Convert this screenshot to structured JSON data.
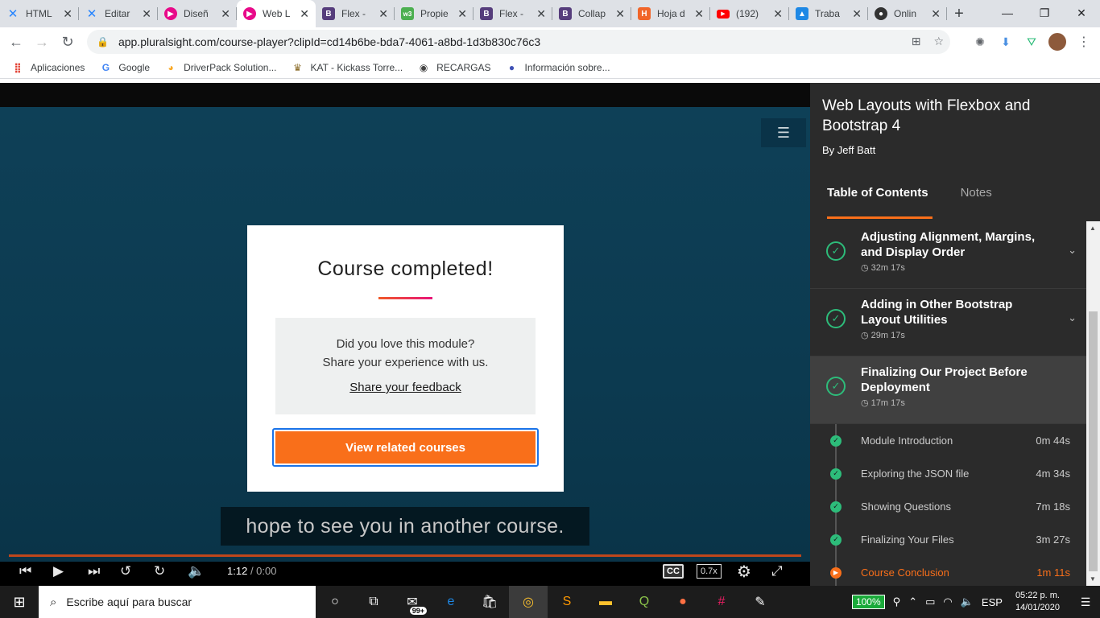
{
  "browser": {
    "tabs": [
      {
        "title": "HTML",
        "icon": "confluence-icon",
        "color": "#2684ff"
      },
      {
        "title": "Editar",
        "icon": "confluence-icon",
        "color": "#2684ff"
      },
      {
        "title": "Diseñ",
        "icon": "pluralsight-icon",
        "color": "#e80a89"
      },
      {
        "title": "Web L",
        "icon": "pluralsight-icon",
        "color": "#e80a89",
        "active": true
      },
      {
        "title": "Flex -",
        "icon": "bootstrap-icon",
        "color": "#563d7c"
      },
      {
        "title": "Propie",
        "icon": "w3schools-icon",
        "color": "#4caf50"
      },
      {
        "title": "Flex -",
        "icon": "bootstrap-icon",
        "color": "#563d7c"
      },
      {
        "title": "Collap",
        "icon": "bootstrap-icon",
        "color": "#563d7c"
      },
      {
        "title": "Hoja d",
        "icon": "html-doc-icon",
        "color": "#f16529"
      },
      {
        "title": "(192)",
        "icon": "youtube-icon",
        "color": "#ff0000"
      },
      {
        "title": "Traba",
        "icon": "site-icon",
        "color": "#1e88e5"
      },
      {
        "title": "Onlin",
        "icon": "github-icon",
        "color": "#333333"
      }
    ],
    "url": "app.pluralsight.com/course-player?clipId=cd14b6be-bda7-4061-a8bd-1d3b830c76c3",
    "bookmarks": [
      {
        "label": "Aplicaciones",
        "icon": "apps-grid-icon"
      },
      {
        "label": "Google",
        "icon": "google-icon"
      },
      {
        "label": "DriverPack Solution...",
        "icon": "driverpack-icon"
      },
      {
        "label": "KAT - Kickass Torre...",
        "icon": "kat-icon"
      },
      {
        "label": "RECARGAS",
        "icon": "recargas-icon"
      },
      {
        "label": "Información sobre...",
        "icon": "info-site-icon"
      }
    ]
  },
  "player": {
    "card": {
      "title": "Course completed!",
      "feedback_line1": "Did you love this module?",
      "feedback_line2": "Share your experience with us.",
      "feedback_link": "Share your feedback",
      "button": "View related courses"
    },
    "caption": "hope to see you in another course.",
    "time_current": "1:12",
    "time_total": "/ 0:00",
    "cc_label": "CC",
    "speed": "0.7x"
  },
  "sidebar": {
    "course_title": "Web Layouts with Flexbox and Bootstrap 4",
    "author": "By Jeff Batt",
    "tabs": [
      {
        "label": "Table of Contents",
        "active": true
      },
      {
        "label": "Notes",
        "active": false
      }
    ],
    "modules": [
      {
        "title": "Adjusting Alignment, Margins, and Display Order",
        "duration": "32m 17s"
      },
      {
        "title": "Adding in Other Bootstrap Layout Utilities",
        "duration": "29m 17s"
      },
      {
        "title": "Finalizing Our Project Before Deployment",
        "duration": "17m 17s"
      }
    ],
    "clips": [
      {
        "title": "Module Introduction",
        "duration": "0m 44s"
      },
      {
        "title": "Exploring the JSON file",
        "duration": "4m 34s"
      },
      {
        "title": "Showing Questions",
        "duration": "7m 18s"
      },
      {
        "title": "Finalizing Your Files",
        "duration": "3m 27s"
      },
      {
        "title": "Course Conclusion",
        "duration": "1m 11s",
        "current": true
      }
    ]
  },
  "taskbar": {
    "search_placeholder": "Escribe aquí para buscar",
    "badge": "99+",
    "battery": "100%",
    "language": "ESP",
    "time": "05:22 p. m.",
    "date": "14/01/2020"
  },
  "colors": {
    "accent": "#f96f1a",
    "complete": "#2dbc7a"
  }
}
